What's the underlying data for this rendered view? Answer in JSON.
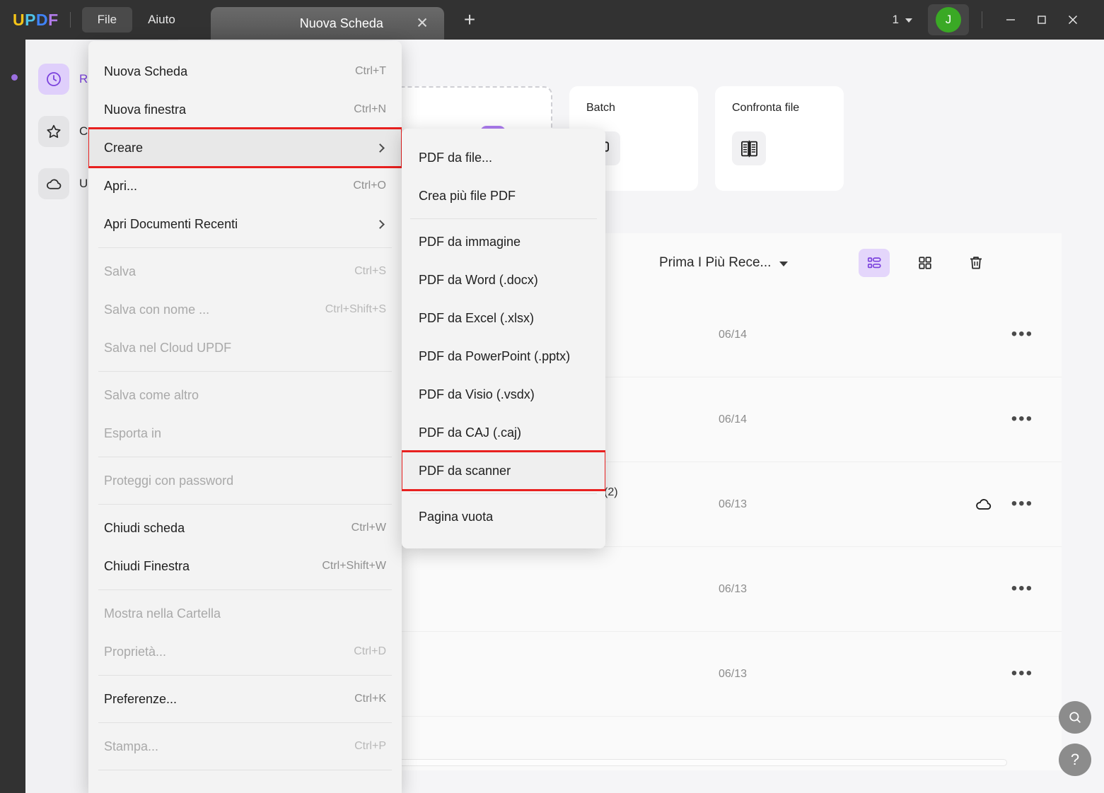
{
  "titlebar": {
    "logo": "UPDF",
    "logo_letters": [
      "U",
      "P",
      "D",
      "F"
    ],
    "logo_colors": [
      "#f5c518",
      "#4ec3e8",
      "#3f83f8",
      "#b07ae8"
    ],
    "menus": [
      {
        "label": "File",
        "active": true
      },
      {
        "label": "Aiuto",
        "active": false
      }
    ],
    "tab": {
      "label": "Nuova Scheda",
      "close": "✕"
    },
    "new_tab": "+",
    "zoom_value": "1",
    "avatar_initial": "J",
    "window_controls": [
      "minimize-icon",
      "maximize-icon",
      "close-icon"
    ]
  },
  "sidebar": {
    "items": [
      {
        "label": "Recenti",
        "icon": "clock-icon",
        "active": true
      },
      {
        "label": "Contrassegnati",
        "icon": "star-icon",
        "active": false
      },
      {
        "label": "UPDF Cloud",
        "icon": "cloud-icon",
        "active": false
      }
    ]
  },
  "main": {
    "cards": [
      {
        "title": "",
        "icon": "open-file-card",
        "type": "dashed",
        "go": "›"
      },
      {
        "title": "Batch",
        "icon": "batch-icon",
        "type": "card"
      },
      {
        "title": "Confronta file",
        "icon": "compare-icon",
        "type": "card"
      }
    ],
    "toolbar": {
      "sort_label": "Prima I Più Rece...",
      "view_list": "list-view-icon",
      "view_grid": "grid-view-icon",
      "delete": "trash-icon"
    },
    "files": [
      {
        "name": "",
        "date": "06/14",
        "cloud": false,
        "menu": "•••"
      },
      {
        "name": "",
        "date": "06/14",
        "cloud": false,
        "menu": "•••"
      },
      {
        "name": "",
        "date": "06/13",
        "cloud": true,
        "menu": "•••"
      },
      {
        "name": "",
        "date": "06/13",
        "cloud": false,
        "menu": "•••"
      },
      {
        "name": "",
        "date": "06/13",
        "cloud": false,
        "menu": "•••"
      }
    ],
    "count_badge": "(2)",
    "fab_search": "search-icon",
    "fab_help": "?"
  },
  "file_menu": {
    "items": [
      {
        "label": "Nuova Scheda",
        "shortcut": "Ctrl+T",
        "disabled": false,
        "submenu": false,
        "selected": false
      },
      {
        "label": "Nuova finestra",
        "shortcut": "Ctrl+N",
        "disabled": false,
        "submenu": false,
        "selected": false
      },
      {
        "label": "Creare",
        "shortcut": "",
        "disabled": false,
        "submenu": true,
        "selected": true
      },
      {
        "label": "Apri...",
        "shortcut": "Ctrl+O",
        "disabled": false,
        "submenu": false,
        "selected": false
      },
      {
        "label": "Apri Documenti Recenti",
        "shortcut": "",
        "disabled": false,
        "submenu": true,
        "selected": false
      },
      {
        "sep": true
      },
      {
        "label": "Salva",
        "shortcut": "Ctrl+S",
        "disabled": true,
        "submenu": false,
        "selected": false
      },
      {
        "label": "Salva con nome ...",
        "shortcut": "Ctrl+Shift+S",
        "disabled": true,
        "submenu": false,
        "selected": false
      },
      {
        "label": "Salva nel Cloud UPDF",
        "shortcut": "",
        "disabled": true,
        "submenu": false,
        "selected": false
      },
      {
        "sep": true
      },
      {
        "label": "Salva come altro",
        "shortcut": "",
        "disabled": true,
        "submenu": false,
        "selected": false
      },
      {
        "label": "Esporta in",
        "shortcut": "",
        "disabled": true,
        "submenu": false,
        "selected": false
      },
      {
        "sep": true
      },
      {
        "label": "Proteggi con password",
        "shortcut": "",
        "disabled": true,
        "submenu": false,
        "selected": false
      },
      {
        "sep": true
      },
      {
        "label": "Chiudi scheda",
        "shortcut": "Ctrl+W",
        "disabled": false,
        "submenu": false,
        "selected": false
      },
      {
        "label": "Chiudi Finestra",
        "shortcut": "Ctrl+Shift+W",
        "disabled": false,
        "submenu": false,
        "selected": false
      },
      {
        "sep": true
      },
      {
        "label": "Mostra nella Cartella",
        "shortcut": "",
        "disabled": true,
        "submenu": false,
        "selected": false
      },
      {
        "label": "Proprietà...",
        "shortcut": "Ctrl+D",
        "disabled": true,
        "submenu": false,
        "selected": false
      },
      {
        "sep": true
      },
      {
        "label": "Preferenze...",
        "shortcut": "Ctrl+K",
        "disabled": false,
        "submenu": false,
        "selected": false
      },
      {
        "sep": true
      },
      {
        "label": "Stampa...",
        "shortcut": "Ctrl+P",
        "disabled": true,
        "submenu": false,
        "selected": false
      },
      {
        "sep": true
      }
    ]
  },
  "create_submenu": {
    "items": [
      {
        "label": "PDF da file...",
        "selected": false
      },
      {
        "label": "Crea più file PDF",
        "selected": false
      },
      {
        "sep": true
      },
      {
        "label": "PDF da immagine",
        "selected": false
      },
      {
        "label": "PDF da Word (.docx)",
        "selected": false
      },
      {
        "label": "PDF da Excel (.xlsx)",
        "selected": false
      },
      {
        "label": "PDF da PowerPoint (.pptx)",
        "selected": false
      },
      {
        "label": "PDF da Visio (.vsdx)",
        "selected": false
      },
      {
        "label": "PDF da CAJ (.caj)",
        "selected": false
      },
      {
        "label": "PDF da scanner",
        "selected": true
      },
      {
        "sep": true
      },
      {
        "label": "Pagina vuota",
        "selected": false
      }
    ]
  },
  "colors": {
    "accent_purple": "#7b42dd",
    "highlight_red": "#e8201f",
    "titlebar_bg": "#323232",
    "avatar_green": "#3aa925"
  }
}
